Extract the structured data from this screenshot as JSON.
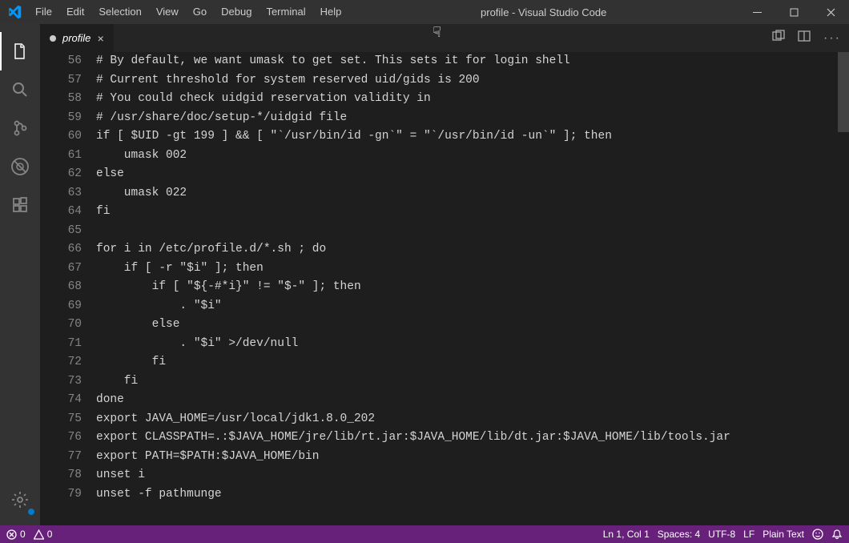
{
  "window": {
    "title": "profile - Visual Studio Code"
  },
  "menubar": {
    "items": [
      "File",
      "Edit",
      "Selection",
      "View",
      "Go",
      "Debug",
      "Terminal",
      "Help"
    ]
  },
  "activitybar": {
    "icons": [
      "files",
      "search",
      "source-control",
      "debug-disabled",
      "extensions"
    ],
    "bottom_icon": "settings-gear"
  },
  "tabs": {
    "items": [
      {
        "label": "profile",
        "dirty": true,
        "active": true
      }
    ]
  },
  "editor": {
    "first_line_no": 56,
    "lines": [
      "# By default, we want umask to get set. This sets it for login shell",
      "# Current threshold for system reserved uid/gids is 200",
      "# You could check uidgid reservation validity in",
      "# /usr/share/doc/setup-*/uidgid file",
      "if [ $UID -gt 199 ] && [ \"`/usr/bin/id -gn`\" = \"`/usr/bin/id -un`\" ]; then",
      "    umask 002",
      "else",
      "    umask 022",
      "fi",
      "",
      "for i in /etc/profile.d/*.sh ; do",
      "    if [ -r \"$i\" ]; then",
      "        if [ \"${-#*i}\" != \"$-\" ]; then",
      "            . \"$i\"",
      "        else",
      "            . \"$i\" >/dev/null",
      "        fi",
      "    fi",
      "done",
      "export JAVA_HOME=/usr/local/jdk1.8.0_202",
      "export CLASSPATH=.:$JAVA_HOME/jre/lib/rt.jar:$JAVA_HOME/lib/dt.jar:$JAVA_HOME/lib/tools.jar",
      "export PATH=$PATH:$JAVA_HOME/bin",
      "unset i",
      "unset -f pathmunge"
    ]
  },
  "statusbar": {
    "errors": "0",
    "warnings": "0",
    "position": "Ln 1, Col 1",
    "indent": "Spaces: 4",
    "encoding": "UTF-8",
    "eol": "LF",
    "language": "Plain Text"
  }
}
